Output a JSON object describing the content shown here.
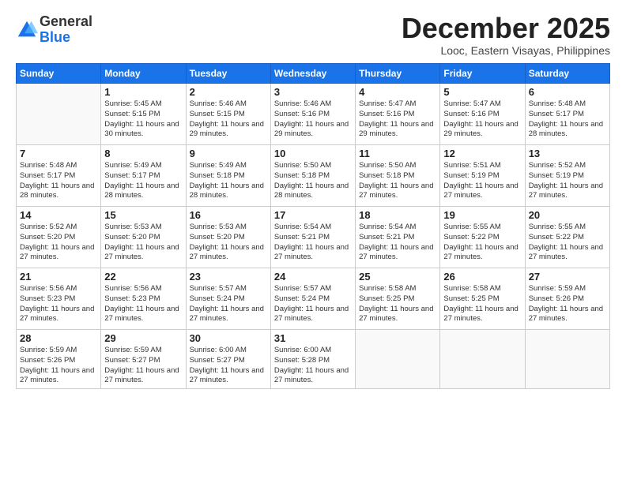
{
  "logo": {
    "general": "General",
    "blue": "Blue"
  },
  "title": "December 2025",
  "location": "Looc, Eastern Visayas, Philippines",
  "days_header": [
    "Sunday",
    "Monday",
    "Tuesday",
    "Wednesday",
    "Thursday",
    "Friday",
    "Saturday"
  ],
  "weeks": [
    [
      {
        "num": "",
        "sunrise": "",
        "sunset": "",
        "daylight": ""
      },
      {
        "num": "1",
        "sunrise": "Sunrise: 5:45 AM",
        "sunset": "Sunset: 5:15 PM",
        "daylight": "Daylight: 11 hours and 30 minutes."
      },
      {
        "num": "2",
        "sunrise": "Sunrise: 5:46 AM",
        "sunset": "Sunset: 5:15 PM",
        "daylight": "Daylight: 11 hours and 29 minutes."
      },
      {
        "num": "3",
        "sunrise": "Sunrise: 5:46 AM",
        "sunset": "Sunset: 5:16 PM",
        "daylight": "Daylight: 11 hours and 29 minutes."
      },
      {
        "num": "4",
        "sunrise": "Sunrise: 5:47 AM",
        "sunset": "Sunset: 5:16 PM",
        "daylight": "Daylight: 11 hours and 29 minutes."
      },
      {
        "num": "5",
        "sunrise": "Sunrise: 5:47 AM",
        "sunset": "Sunset: 5:16 PM",
        "daylight": "Daylight: 11 hours and 29 minutes."
      },
      {
        "num": "6",
        "sunrise": "Sunrise: 5:48 AM",
        "sunset": "Sunset: 5:17 PM",
        "daylight": "Daylight: 11 hours and 28 minutes."
      }
    ],
    [
      {
        "num": "7",
        "sunrise": "Sunrise: 5:48 AM",
        "sunset": "Sunset: 5:17 PM",
        "daylight": "Daylight: 11 hours and 28 minutes."
      },
      {
        "num": "8",
        "sunrise": "Sunrise: 5:49 AM",
        "sunset": "Sunset: 5:17 PM",
        "daylight": "Daylight: 11 hours and 28 minutes."
      },
      {
        "num": "9",
        "sunrise": "Sunrise: 5:49 AM",
        "sunset": "Sunset: 5:18 PM",
        "daylight": "Daylight: 11 hours and 28 minutes."
      },
      {
        "num": "10",
        "sunrise": "Sunrise: 5:50 AM",
        "sunset": "Sunset: 5:18 PM",
        "daylight": "Daylight: 11 hours and 28 minutes."
      },
      {
        "num": "11",
        "sunrise": "Sunrise: 5:50 AM",
        "sunset": "Sunset: 5:18 PM",
        "daylight": "Daylight: 11 hours and 27 minutes."
      },
      {
        "num": "12",
        "sunrise": "Sunrise: 5:51 AM",
        "sunset": "Sunset: 5:19 PM",
        "daylight": "Daylight: 11 hours and 27 minutes."
      },
      {
        "num": "13",
        "sunrise": "Sunrise: 5:52 AM",
        "sunset": "Sunset: 5:19 PM",
        "daylight": "Daylight: 11 hours and 27 minutes."
      }
    ],
    [
      {
        "num": "14",
        "sunrise": "Sunrise: 5:52 AM",
        "sunset": "Sunset: 5:20 PM",
        "daylight": "Daylight: 11 hours and 27 minutes."
      },
      {
        "num": "15",
        "sunrise": "Sunrise: 5:53 AM",
        "sunset": "Sunset: 5:20 PM",
        "daylight": "Daylight: 11 hours and 27 minutes."
      },
      {
        "num": "16",
        "sunrise": "Sunrise: 5:53 AM",
        "sunset": "Sunset: 5:20 PM",
        "daylight": "Daylight: 11 hours and 27 minutes."
      },
      {
        "num": "17",
        "sunrise": "Sunrise: 5:54 AM",
        "sunset": "Sunset: 5:21 PM",
        "daylight": "Daylight: 11 hours and 27 minutes."
      },
      {
        "num": "18",
        "sunrise": "Sunrise: 5:54 AM",
        "sunset": "Sunset: 5:21 PM",
        "daylight": "Daylight: 11 hours and 27 minutes."
      },
      {
        "num": "19",
        "sunrise": "Sunrise: 5:55 AM",
        "sunset": "Sunset: 5:22 PM",
        "daylight": "Daylight: 11 hours and 27 minutes."
      },
      {
        "num": "20",
        "sunrise": "Sunrise: 5:55 AM",
        "sunset": "Sunset: 5:22 PM",
        "daylight": "Daylight: 11 hours and 27 minutes."
      }
    ],
    [
      {
        "num": "21",
        "sunrise": "Sunrise: 5:56 AM",
        "sunset": "Sunset: 5:23 PM",
        "daylight": "Daylight: 11 hours and 27 minutes."
      },
      {
        "num": "22",
        "sunrise": "Sunrise: 5:56 AM",
        "sunset": "Sunset: 5:23 PM",
        "daylight": "Daylight: 11 hours and 27 minutes."
      },
      {
        "num": "23",
        "sunrise": "Sunrise: 5:57 AM",
        "sunset": "Sunset: 5:24 PM",
        "daylight": "Daylight: 11 hours and 27 minutes."
      },
      {
        "num": "24",
        "sunrise": "Sunrise: 5:57 AM",
        "sunset": "Sunset: 5:24 PM",
        "daylight": "Daylight: 11 hours and 27 minutes."
      },
      {
        "num": "25",
        "sunrise": "Sunrise: 5:58 AM",
        "sunset": "Sunset: 5:25 PM",
        "daylight": "Daylight: 11 hours and 27 minutes."
      },
      {
        "num": "26",
        "sunrise": "Sunrise: 5:58 AM",
        "sunset": "Sunset: 5:25 PM",
        "daylight": "Daylight: 11 hours and 27 minutes."
      },
      {
        "num": "27",
        "sunrise": "Sunrise: 5:59 AM",
        "sunset": "Sunset: 5:26 PM",
        "daylight": "Daylight: 11 hours and 27 minutes."
      }
    ],
    [
      {
        "num": "28",
        "sunrise": "Sunrise: 5:59 AM",
        "sunset": "Sunset: 5:26 PM",
        "daylight": "Daylight: 11 hours and 27 minutes."
      },
      {
        "num": "29",
        "sunrise": "Sunrise: 5:59 AM",
        "sunset": "Sunset: 5:27 PM",
        "daylight": "Daylight: 11 hours and 27 minutes."
      },
      {
        "num": "30",
        "sunrise": "Sunrise: 6:00 AM",
        "sunset": "Sunset: 5:27 PM",
        "daylight": "Daylight: 11 hours and 27 minutes."
      },
      {
        "num": "31",
        "sunrise": "Sunrise: 6:00 AM",
        "sunset": "Sunset: 5:28 PM",
        "daylight": "Daylight: 11 hours and 27 minutes."
      },
      {
        "num": "",
        "sunrise": "",
        "sunset": "",
        "daylight": ""
      },
      {
        "num": "",
        "sunrise": "",
        "sunset": "",
        "daylight": ""
      },
      {
        "num": "",
        "sunrise": "",
        "sunset": "",
        "daylight": ""
      }
    ]
  ]
}
